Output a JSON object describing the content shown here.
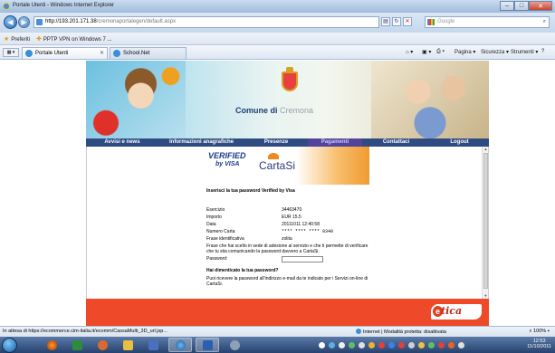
{
  "window": {
    "title": "Portale Utenti - Windows Internet Explorer",
    "controls": {
      "minimize": "–",
      "maximize": "□",
      "close": "✕"
    }
  },
  "address_bar": {
    "url_host": "http://193.201.171.38",
    "url_path": "/cremonaportalegen/default.aspx",
    "search_placeholder": "Google"
  },
  "favorites_bar": {
    "favorites_label": "Preferiti",
    "items": [
      {
        "label": "PPTP VPN on Windows 7 ..."
      }
    ]
  },
  "tabs": [
    {
      "label": "Portale Utenti",
      "active": true
    },
    {
      "label": "School.Net",
      "active": false
    }
  ],
  "command_bar": {
    "items": [
      "Pagina ▾",
      "Sicurezza ▾",
      "Strumenti ▾"
    ]
  },
  "site": {
    "banner": {
      "title_pre": "Comune di",
      "title_main": "Comune di",
      "title_post": "Cremona"
    },
    "menu": [
      {
        "label": "Avvisi e news",
        "active": false
      },
      {
        "label": "Informazioni anagrafiche",
        "active": false
      },
      {
        "label": "Presenze",
        "active": false
      },
      {
        "label": "Pagamenti",
        "active": true
      },
      {
        "label": "Contattaci",
        "active": false
      },
      {
        "label": "Logout",
        "active": false
      }
    ],
    "vbv": {
      "verified": "VERIFIED",
      "by_visa": "by VISA",
      "cartasi": "CartaSi",
      "prompt": "Inserisci la tua password Verified by Visa"
    },
    "transaction": [
      {
        "label": "Esercizio",
        "value": "34463470"
      },
      {
        "label": "Importo",
        "value": "EUR 15.5"
      },
      {
        "label": "Data",
        "value": "20111011 12:40:58"
      },
      {
        "label": "Numero Carta",
        "value": "**** **** **** 9340"
      },
      {
        "label": "Frase identificativa",
        "value": "zolita"
      }
    ],
    "phrase_note": "Frase che hai scelto in sede di adesione al servizio e che ti permette di verificare che tu stia comunicando la password davvero a CartaSi.",
    "password_label": "Password:",
    "forgot_title": "Hai dimenticato la tua password?",
    "forgot_text": "Puoi ricevere la password all'indirizzo e-mail da te indicato per i Servizi on-line di CartaSi.",
    "footer_brand": "tica",
    "footer_brand_initial": "e"
  },
  "status_bar": {
    "text": "In attesa di https://ecommerce.cim-italia.it/ecomm/CassaMulti_3D_url.jsp...",
    "zone": "Internet | Modalità protetta: disattivata",
    "zoom": "100%"
  },
  "taskbar": {
    "time": "12:53",
    "date": "11/10/2011"
  },
  "colors": {
    "menu_bg": "#2f4c82",
    "menu_active": "#52449a",
    "footer": "#ee4a2a",
    "vbv_orange": "#f09a30"
  }
}
